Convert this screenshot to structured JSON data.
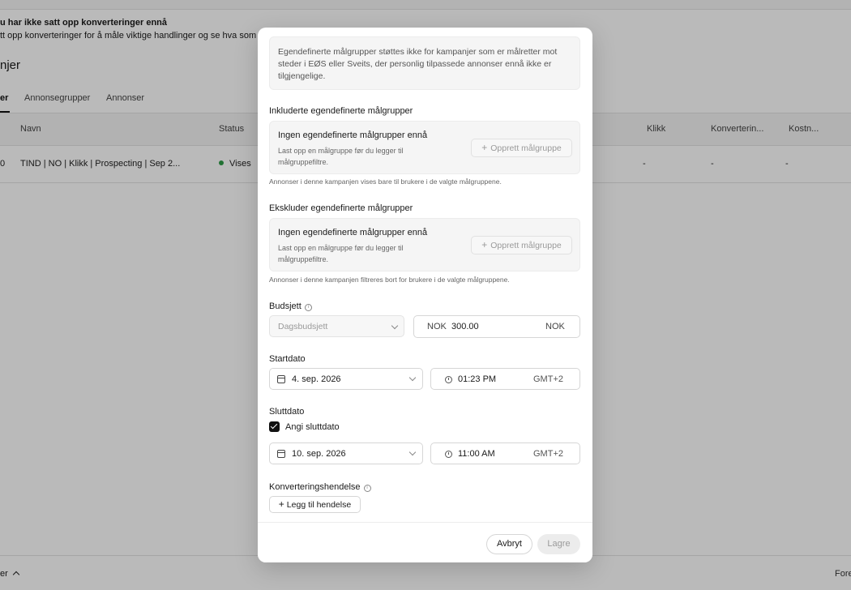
{
  "background": {
    "alert_title": "u har ikke satt opp konverteringer ennå",
    "alert_body": "tt opp konverteringer for å måle viktige handlinger og se hva som g",
    "page_heading": "njer",
    "tabs": [
      {
        "label": "er",
        "active": true
      },
      {
        "label": "Annonsegrupper",
        "active": false
      },
      {
        "label": "Annonser",
        "active": false
      }
    ],
    "table": {
      "headers": [
        "Navn",
        "Status",
        "Klikk",
        "Konverterin...",
        "Kostn..."
      ],
      "rows": [
        {
          "lead": "0",
          "name": "TIND | NO | Klikk | Prospecting | Sep 2...",
          "status": "Vises",
          "clicks": "-",
          "conversions": "-",
          "cost": "-"
        }
      ]
    },
    "footer_left": "er",
    "footer_right": "Fore",
    "status_color": "#2e9b47"
  },
  "modal": {
    "info_notice": "Egendefinerte målgrupper støttes ikke for kampanjer som er målretter mot steder i EØS eller Sveits, der personlig tilpassede annonser ennå ikke er tilgjengelige.",
    "include": {
      "label": "Inkluderte egendefinerte målgrupper",
      "empty_title": "Ingen egendefinerte målgrupper ennå",
      "empty_desc": "Last opp en målgruppe før du legger til målgruppefiltre.",
      "create_button": "Opprett målgruppe",
      "hint": "Annonser i denne kampanjen vises bare til brukere i de valgte målgruppene."
    },
    "exclude": {
      "label": "Ekskluder egendefinerte målgrupper",
      "empty_title": "Ingen egendefinerte målgrupper ennå",
      "empty_desc": "Last opp en målgruppe før du legger til målgruppefiltre.",
      "create_button": "Opprett målgruppe",
      "hint": "Annonser i denne kampanjen filtreres bort for brukere i de valgte målgruppene."
    },
    "budget": {
      "label": "Budsjett",
      "type_value": "Dagsbudsjett",
      "currency_prefix": "NOK",
      "amount": "300.00",
      "currency_suffix": "NOK"
    },
    "start": {
      "label": "Startdato",
      "date": "4. sep. 2026",
      "time": "01:23 PM",
      "timezone": "GMT+2"
    },
    "end": {
      "label": "Sluttdato",
      "checkbox_label": "Angi sluttdato",
      "checked": true,
      "date": "10. sep. 2026",
      "time": "11:00 AM",
      "timezone": "GMT+2"
    },
    "conversion": {
      "label": "Konverteringshendelse",
      "add_button": "Legg til hendelse"
    },
    "footer": {
      "cancel": "Avbryt",
      "save": "Lagre"
    }
  }
}
